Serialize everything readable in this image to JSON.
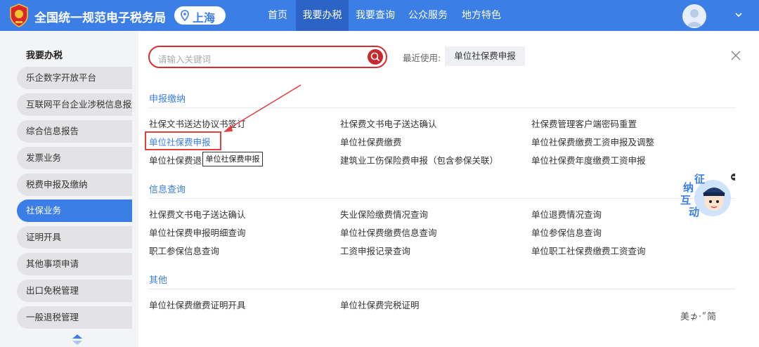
{
  "header": {
    "site_title": "全国统一规范电子税务局",
    "region": "上海",
    "nav": [
      "首页",
      "我要办税",
      "我要查询",
      "公众服务",
      "地方特色"
    ],
    "active_nav": "我要办税"
  },
  "sidebar": {
    "title": "我要办税",
    "items": [
      "乐企数字开放平台",
      "互联网平台企业涉税信息报送",
      "综合信息报告",
      "发票业务",
      "税费申报及缴纳",
      "社保业务",
      "证明开具",
      "其他事项申请",
      "出口免税管理",
      "一般退税管理"
    ],
    "active_item": "社保业务"
  },
  "search": {
    "placeholder": "请输入关键词"
  },
  "recent": {
    "label": "最近使用:",
    "item": "单位社保费申报"
  },
  "sections": [
    {
      "title": "申报缴纳",
      "links": [
        "社保文书送达协议书签订",
        "社保费文书电子送达确认",
        "社保费管理客户端密码重置",
        "单位社保费申报",
        "单位社保费缴费",
        "单位社保费缴费工资申报及调整",
        "单位社保费退费",
        "建筑业工伤保险费申报（包含参保关联）",
        "单位社保费年度缴费工资申报"
      ]
    },
    {
      "title": "信息查询",
      "links": [
        "社保费文书电子送达确认",
        "失业保险缴费情况查询",
        "单位退费情况查询",
        "单位社保费申报明细查询",
        "单位社保费缴费信息查询",
        "单位参保信息查询",
        "职工参保信息查询",
        "工资申报记录查询",
        "单位职工社保费缴费工资查询"
      ]
    },
    {
      "title": "其他",
      "links": [
        "单位社保费缴费证明开具",
        "单位社保费完税证明"
      ]
    }
  ],
  "tooltip": "单位社保费申报",
  "mascot_text": [
    "征",
    "纳",
    "互",
    "动"
  ],
  "watermark": "美⊅·ʺ简",
  "colors": {
    "header": "#3a7ee6",
    "accent": "#3a7ee6",
    "search_border": "#d32f2f",
    "highlight_box": "#e04040"
  }
}
